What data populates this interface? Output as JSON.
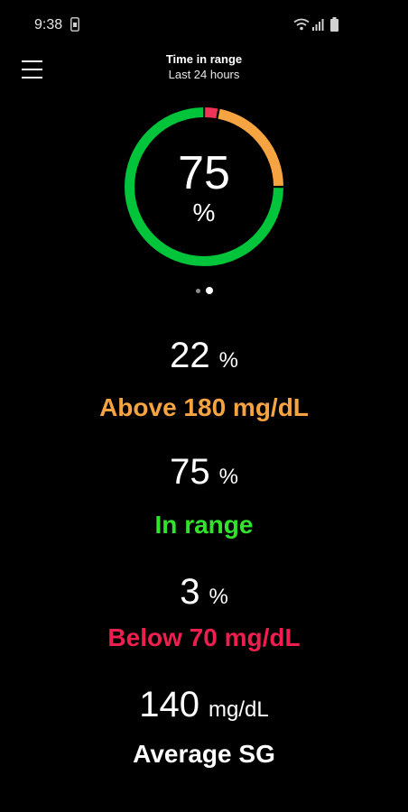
{
  "status_bar": {
    "time": "9:38",
    "icons": [
      "sim-icon",
      "wifi-icon",
      "signal-icon",
      "battery-icon"
    ]
  },
  "header": {
    "title": "Time in range",
    "subtitle": "Last 24 hours"
  },
  "ring": {
    "value": "75",
    "unit": "%",
    "segments": [
      {
        "label": "Below 70 mg/dL",
        "percent": 3,
        "color": "#ee3456"
      },
      {
        "label": "Above 180 mg/dL",
        "percent": 22,
        "color": "#f6a341"
      },
      {
        "label": "In range",
        "percent": 75,
        "color": "#00c43a"
      }
    ],
    "gap_color": "#ffffff"
  },
  "pager": {
    "pages": 2,
    "active_index": 1
  },
  "stats": [
    {
      "value": "22",
      "unit": "%",
      "label": "Above 180 mg/dL",
      "color": "#f6a341"
    },
    {
      "value": "75",
      "unit": "%",
      "label": "In range",
      "color": "#32e32b"
    },
    {
      "value": "3",
      "unit": "%",
      "label": "Below 70 mg/dL",
      "color": "#ee1f4f"
    },
    {
      "value": "140",
      "unit": "mg/dL",
      "label": "Average SG",
      "color": "#ffffff"
    }
  ]
}
